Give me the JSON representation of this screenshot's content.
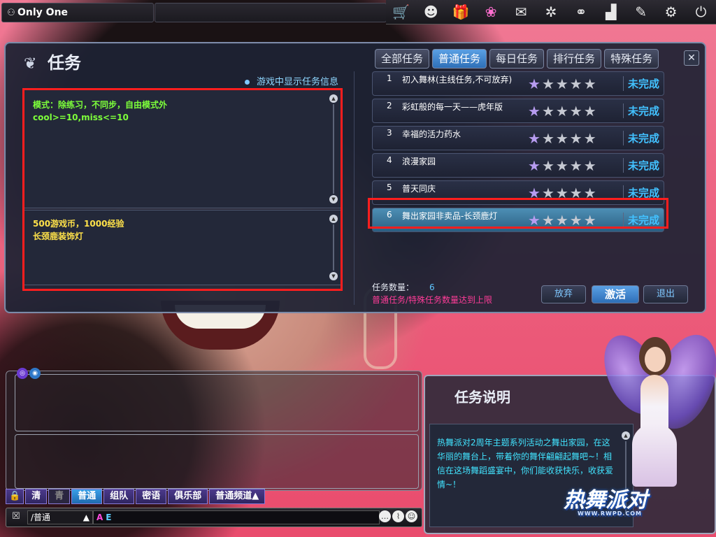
{
  "topbar": {
    "player_name": "Only One",
    "icons": [
      "shop-cart-icon",
      "mask-icon",
      "gift-box-icon",
      "logo-icon",
      "chat-bubble-icon",
      "dance-icon",
      "couple-icon",
      "podium-icon",
      "notebook-icon",
      "gear-icon",
      "power-icon"
    ]
  },
  "panel": {
    "title": "任务",
    "tabs": [
      "全部任务",
      "普通任务",
      "每日任务",
      "排行任务",
      "特殊任务"
    ],
    "active_tab": "普通任务",
    "toggle_label": "游戏中显示任务信息",
    "info_mode": "模式：除练习，不同步，自由模式外",
    "info_condition": "cool>=10,miss<=10",
    "reward_line1": "500游戏币，1000经验",
    "reward_line2": "长颈鹿装饰灯",
    "quests": [
      {
        "num": "1",
        "name": "初入舞林(主线任务,不可放弃)",
        "stars": 1,
        "status": "未完成"
      },
      {
        "num": "2",
        "name": "彩虹般的每一天——虎年版",
        "stars": 1,
        "status": "未完成"
      },
      {
        "num": "3",
        "name": "幸福的活力药水",
        "stars": 1,
        "status": "未完成"
      },
      {
        "num": "4",
        "name": "浪漫家园",
        "stars": 1,
        "status": "未完成"
      },
      {
        "num": "5",
        "name": "普天同庆",
        "stars": 1,
        "status": "未完成"
      },
      {
        "num": "6",
        "name": "舞出家园非卖品-长颈鹿灯",
        "stars": 1,
        "status": "未完成"
      }
    ],
    "quest_count_label": "任务数量：",
    "quest_count": "6",
    "limit_text": "普通任务/特殊任务数量达到上限",
    "buttons": {
      "abandon": "放弃",
      "activate": "激活",
      "exit": "退出"
    }
  },
  "chat": {
    "tabs": [
      "清",
      "青",
      "普通",
      "组队",
      "密语",
      "俱乐部",
      "普通频道▲"
    ],
    "channel": "/普通",
    "channel_arrow": "▲",
    "input_a": "A",
    "input_e": "E"
  },
  "description": {
    "title": "任务说明",
    "text": "热舞派对2周年主题系列活动之舞出家园，在这华丽的舞台上，带着你的舞伴翩翩起舞吧~！相信在这场舞蹈盛宴中，你们能收获快乐，收获爱情~！"
  },
  "logo": {
    "text": "热舞派对",
    "sub": "WWW.RWPD.COM"
  }
}
